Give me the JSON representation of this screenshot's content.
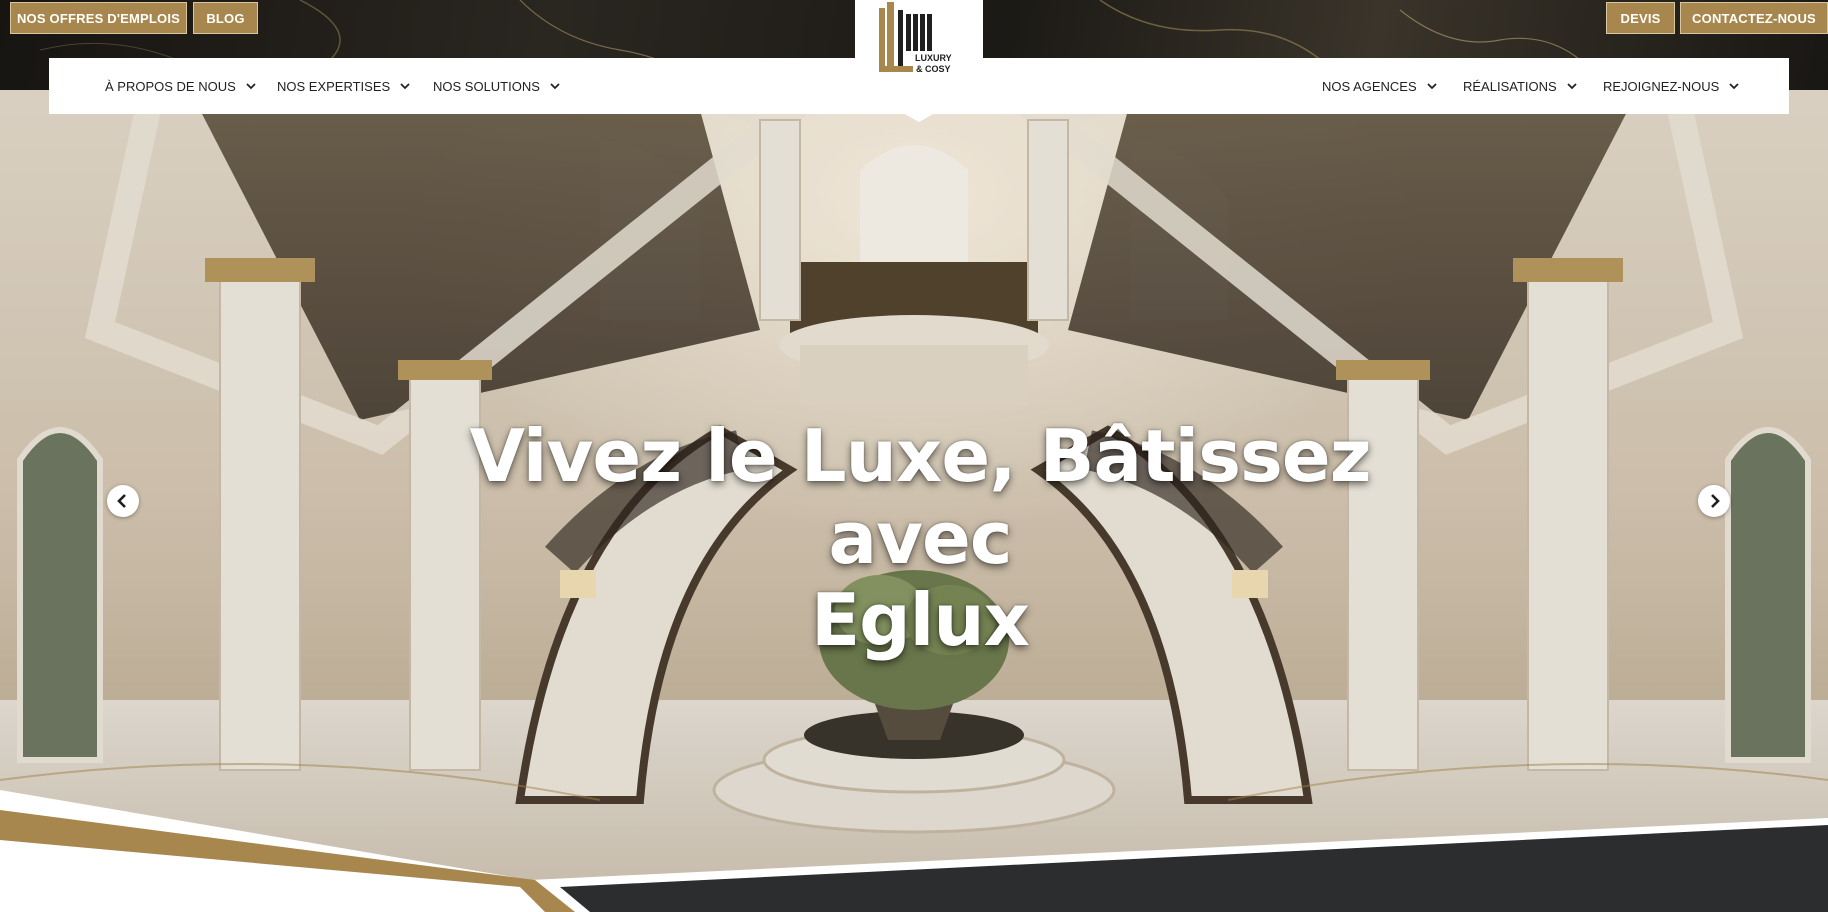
{
  "top_buttons": {
    "jobs_label": "NOS OFFRES D'EMPLOIS",
    "blog_label": "BLOG",
    "devis_label": "DEVIS",
    "contact_label": "CONTACTEZ-NOUS"
  },
  "nav": {
    "left_items": [
      {
        "label": "À PROPOS DE NOUS",
        "icon": "chevron-down-icon"
      },
      {
        "label": "NOS EXPERTISES",
        "icon": "chevron-down-icon"
      },
      {
        "label": "NOS SOLUTIONS",
        "icon": "chevron-down-icon"
      }
    ],
    "right_items": [
      {
        "label": "NOS AGENCES",
        "icon": "chevron-down-icon"
      },
      {
        "label": "RÉALISATIONS",
        "icon": "chevron-down-icon"
      },
      {
        "label": "REJOIGNEZ-NOUS",
        "icon": "chevron-down-icon"
      }
    ]
  },
  "logo": {
    "line1": "LUXURY",
    "line2": "& COSY"
  },
  "hero": {
    "headline_line1": "Vivez le Luxe, Bâtissez avec",
    "headline_line2": "Eglux",
    "prev_icon": "chevron-left-icon",
    "next_icon": "chevron-right-icon"
  },
  "colors": {
    "gold": "#a8874e",
    "dark": "#2b2d2f",
    "white": "#ffffff",
    "text": "#222222"
  }
}
